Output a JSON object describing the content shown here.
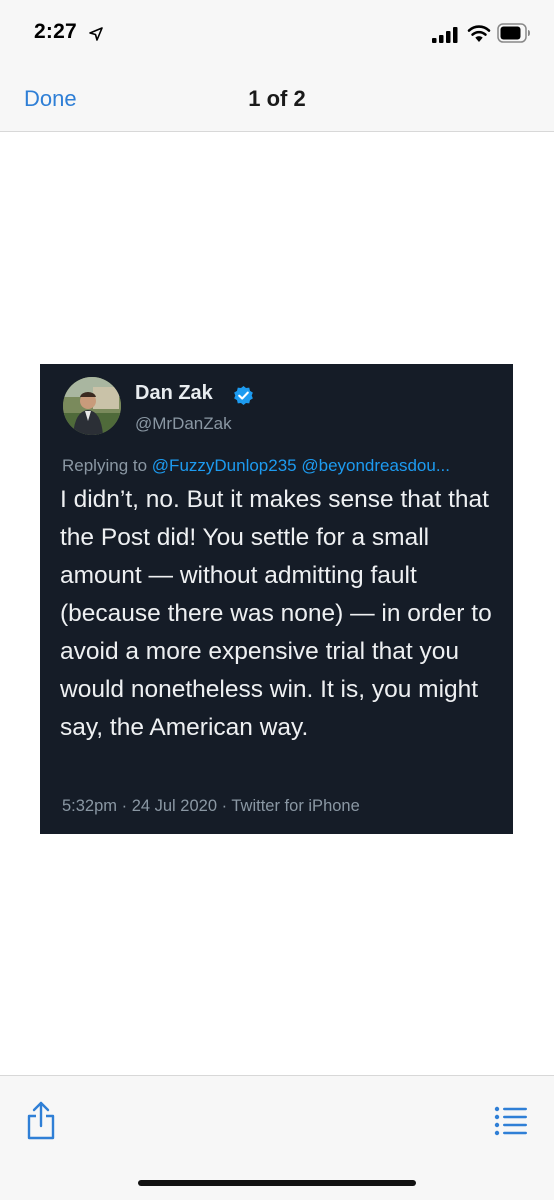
{
  "status_bar": {
    "time": "2:27",
    "icons": [
      "location-arrow-icon",
      "cellular-signal-icon",
      "wifi-icon",
      "battery-icon"
    ]
  },
  "nav": {
    "done_label": "Done",
    "title": "1 of 2"
  },
  "tweet": {
    "author_name": "Dan Zak",
    "handle": "@MrDanZak",
    "reply_prefix": "Replying to",
    "reply_mentions": "@FuzzyDunlop235 @beyondreasdou...",
    "text": "I didn’t, no. But it makes sense that that the Post did! You settle for a small amount — without admitting fault (because there was none) — in order to avoid a more expensive trial that you would nonetheless win. It is, you might say, the American way.",
    "meta": "5:32pm · 24 Jul 2020 · Twitter for iPhone",
    "colors": {
      "background": "#151c27",
      "mention": "#1d9bf0",
      "verified": "#1d9bf0"
    }
  },
  "toolbar": {
    "share_icon": "share-icon",
    "list_icon": "list-icon",
    "accent": "#2f7fd6"
  }
}
